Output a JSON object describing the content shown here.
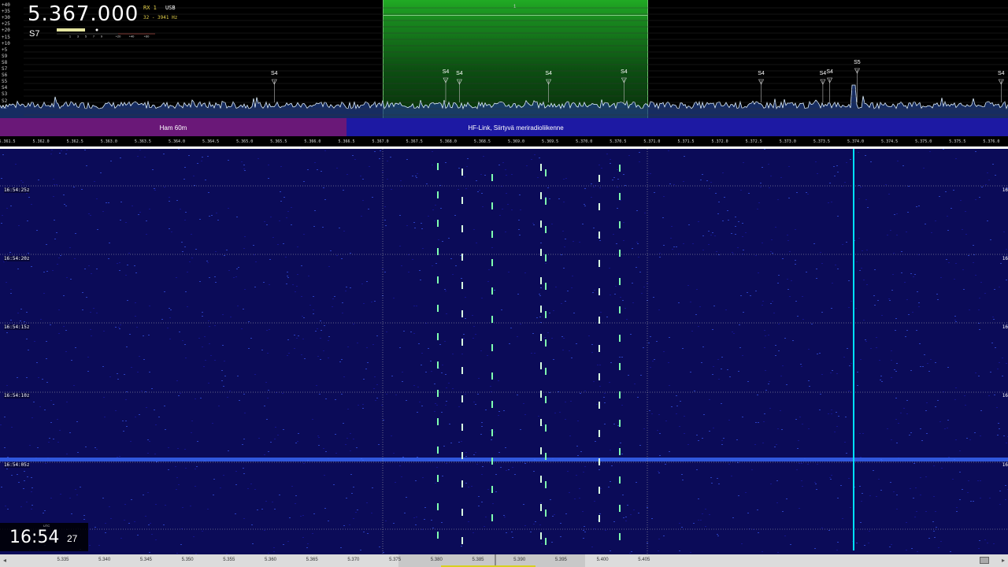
{
  "vfo": {
    "frequency": "5.367.000",
    "rx": "RX 1",
    "mode": "USB",
    "bandwidth": "32 - 3941 Hz",
    "smeter": "S7",
    "smeter_scale": [
      "1",
      "3",
      "5",
      "7",
      "9",
      "+20",
      "+40",
      "+60"
    ],
    "rx_number": "1"
  },
  "db_scale": [
    "+40",
    "+35",
    "+30",
    "+25",
    "+20",
    "+15",
    "+10",
    "+5",
    "S9",
    "S8",
    "S7",
    "S6",
    "S5",
    "S4",
    "S3",
    "S2",
    "S1"
  ],
  "markers": [
    {
      "label": "S4",
      "freq": 5.3655
    },
    {
      "label": "S4",
      "freq": 5.368
    },
    {
      "label": "S4",
      "freq": 5.3682
    },
    {
      "label": "S4",
      "freq": 5.3695
    },
    {
      "label": "S4",
      "freq": 5.3706
    },
    {
      "label": "S4",
      "freq": 5.3726
    },
    {
      "label": "S4",
      "freq": 5.3735
    },
    {
      "label": "S4",
      "freq": 5.3736
    },
    {
      "label": "S5",
      "freq": 5.374
    },
    {
      "label": "S4",
      "freq": 5.3761
    }
  ],
  "bands": {
    "ham": "Ham 60m",
    "hf": "HF-Link, Siirtyvä meriradioliikenne"
  },
  "top_scale": [
    "5.361.5",
    "5.362.0",
    "5.362.5",
    "5.363.0",
    "5.363.5",
    "5.364.0",
    "5.364.5",
    "5.365.0",
    "5.365.5",
    "5.366.0",
    "5.366.5",
    "5.367.0",
    "5.367.5",
    "5.368.0",
    "5.368.5",
    "5.369.0",
    "5.369.5",
    "5.370.0",
    "5.370.5",
    "5.371.0",
    "5.371.5",
    "5.372.0",
    "5.372.5",
    "5.373.0",
    "5.373.5",
    "5.374.0",
    "5.374.5",
    "5.375.0",
    "5.375.5",
    "5.376.0"
  ],
  "waterfall_times": [
    "16:54:25z",
    "16:54:20z",
    "16:54:15z",
    "16:54:10z",
    "16:54:05z"
  ],
  "clock": {
    "utc": "UTC",
    "hm": "16:54",
    "sec": "27"
  },
  "bottom_scale": [
    "5.335",
    "5.340",
    "5.345",
    "5.350",
    "5.355",
    "5.360",
    "5.365",
    "5.370",
    "5.375",
    "5.380",
    "5.385",
    "5.390",
    "5.395",
    "5.400",
    "5.405"
  ],
  "colors": {
    "passband": "#27c92b",
    "ham_band": "#6a1878",
    "hf_band": "#1d19a3",
    "waterfall_bg": "#0a0a55",
    "signal": "#00e0ff"
  }
}
